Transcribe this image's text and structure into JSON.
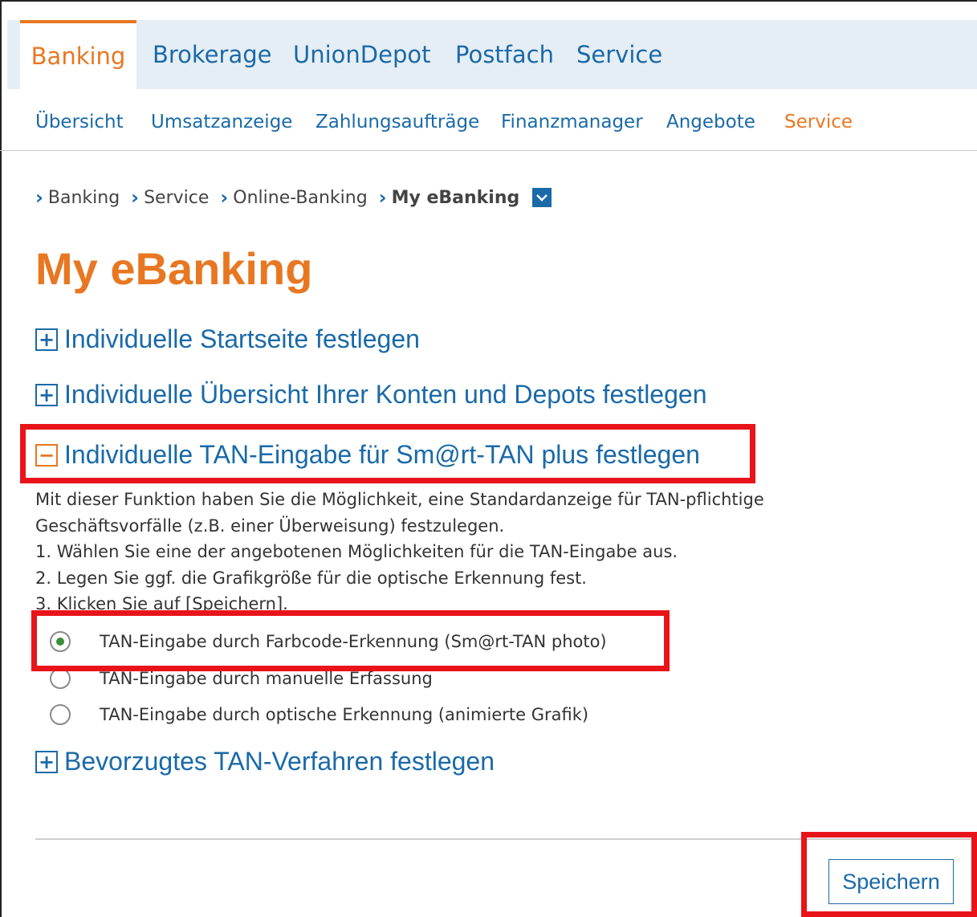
{
  "top_nav": {
    "tabs": [
      {
        "label": "Banking",
        "active": true
      },
      {
        "label": "Brokerage",
        "active": false
      },
      {
        "label": "UnionDepot",
        "active": false
      },
      {
        "label": "Postfach",
        "active": false
      },
      {
        "label": "Service",
        "active": false
      }
    ]
  },
  "sub_nav": {
    "items": [
      {
        "label": "Übersicht",
        "active": false
      },
      {
        "label": "Umsatzanzeige",
        "active": false
      },
      {
        "label": "Zahlungsaufträge",
        "active": false
      },
      {
        "label": "Finanzmanager",
        "active": false
      },
      {
        "label": "Angebote",
        "active": false
      },
      {
        "label": "Service",
        "active": true
      }
    ]
  },
  "breadcrumb": {
    "items": [
      "Banking",
      "Service",
      "Online-Banking",
      "My eBanking"
    ]
  },
  "page": {
    "title": "My eBanking"
  },
  "sections": [
    {
      "label": "Individuelle Startseite festlegen",
      "expanded": false
    },
    {
      "label": "Individuelle Übersicht Ihrer Konten und Depots festlegen",
      "expanded": false
    },
    {
      "label": "Individuelle TAN-Eingabe für Sm@rt-TAN plus festlegen",
      "expanded": true
    },
    {
      "label": "Bevorzugtes TAN-Verfahren festlegen",
      "expanded": false
    }
  ],
  "tan_section": {
    "description_lines": [
      "Mit dieser Funktion haben Sie die Möglichkeit, eine Standardanzeige für TAN-pflichtige",
      "Geschäftsvorfälle (z.B. einer Überweisung) festzulegen.",
      "1. Wählen Sie eine der angebotenen Möglichkeiten für die TAN-Eingabe aus.",
      "2. Legen Sie ggf. die Grafikgröße für die optische Erkennung fest.",
      "3. Klicken Sie auf [Speichern]."
    ],
    "options": [
      {
        "label": "TAN-Eingabe durch Farbcode-Erkennung (Sm@rt-TAN photo)",
        "selected": true
      },
      {
        "label": "TAN-Eingabe durch manuelle Erfassung",
        "selected": false
      },
      {
        "label": "TAN-Eingabe durch optische Erkennung (animierte Grafik)",
        "selected": false
      }
    ]
  },
  "actions": {
    "save_label": "Speichern"
  },
  "colors": {
    "accent": "#e87722",
    "link": "#1a6aa8",
    "highlight": "#e8141a",
    "nav_background": "#e6eef5"
  }
}
